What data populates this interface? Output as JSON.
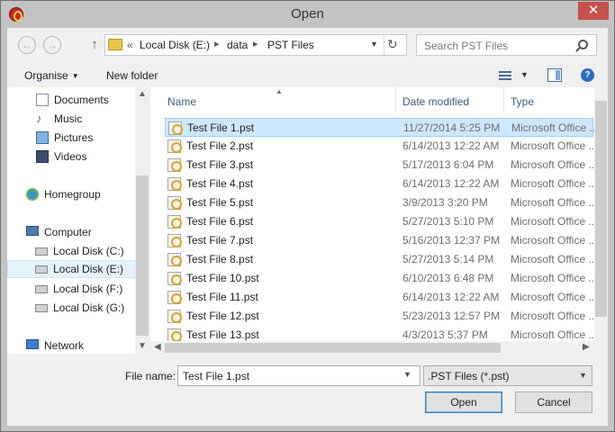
{
  "window": {
    "title": "Open",
    "close_glyph": "✕",
    "app_icon": "app-logo-icon"
  },
  "addressbar": {
    "overflow": "«",
    "crumbs": [
      "Local Disk (E:)",
      "data",
      "PST Files"
    ],
    "separator": "▸"
  },
  "search": {
    "placeholder": "Search PST Files"
  },
  "toolbar": {
    "organise": "Organise",
    "new_folder": "New folder"
  },
  "navpane": {
    "items": [
      {
        "label": "Documents",
        "icon": "documents-icon"
      },
      {
        "label": "Music",
        "icon": "music-icon"
      },
      {
        "label": "Pictures",
        "icon": "pictures-icon"
      },
      {
        "label": "Videos",
        "icon": "videos-icon"
      },
      {
        "label": "Homegroup",
        "icon": "homegroup-icon"
      },
      {
        "label": "Computer",
        "icon": "computer-icon"
      },
      {
        "label": "Local Disk (C:)",
        "icon": "drive-c-icon"
      },
      {
        "label": "Local Disk (E:)",
        "icon": "drive-icon",
        "selected": true
      },
      {
        "label": "Local Disk (F:)",
        "icon": "drive-icon"
      },
      {
        "label": "Local Disk (G:)",
        "icon": "drive-icon"
      },
      {
        "label": "Network",
        "icon": "network-icon"
      }
    ]
  },
  "columns": {
    "name": "Name",
    "date": "Date modified",
    "type": "Type"
  },
  "files": [
    {
      "name": "Test File 1.pst",
      "date": "11/27/2014 5:25 PM",
      "type": "Microsoft Office ..",
      "selected": true
    },
    {
      "name": "Test File 2.pst",
      "date": "6/14/2013 12:22 AM",
      "type": "Microsoft Office .."
    },
    {
      "name": "Test File 3.pst",
      "date": "5/17/2013 6:04 PM",
      "type": "Microsoft Office .."
    },
    {
      "name": "Test File 4.pst",
      "date": "6/14/2013 12:22 AM",
      "type": "Microsoft Office .."
    },
    {
      "name": "Test File 5.pst",
      "date": "3/9/2013 3:20 PM",
      "type": "Microsoft Office .."
    },
    {
      "name": "Test File 6.pst",
      "date": "5/27/2013 5:10 PM",
      "type": "Microsoft Office .."
    },
    {
      "name": "Test File 7.pst",
      "date": "5/16/2013 12:37 PM",
      "type": "Microsoft Office .."
    },
    {
      "name": "Test File 8.pst",
      "date": "5/27/2013 5:14 PM",
      "type": "Microsoft Office .."
    },
    {
      "name": "Test File 10.pst",
      "date": "6/10/2013 6:48 PM",
      "type": "Microsoft Office .."
    },
    {
      "name": "Test File 11.pst",
      "date": "6/14/2013 12:22 AM",
      "type": "Microsoft Office .."
    },
    {
      "name": "Test File 12.pst",
      "date": "5/23/2013 12:57 PM",
      "type": "Microsoft Office .."
    },
    {
      "name": "Test File 13.pst",
      "date": "4/3/2013 5:37 PM",
      "type": "Microsoft Office .."
    }
  ],
  "footer": {
    "filename_label": "File name:",
    "filename_value": "Test File 1.pst",
    "filter": ".PST Files (*.pst)",
    "open": "Open",
    "cancel": "Cancel"
  },
  "colors": {
    "selection": "#cce8ff",
    "accent": "#3c7fb1",
    "close": "#c7504a"
  }
}
